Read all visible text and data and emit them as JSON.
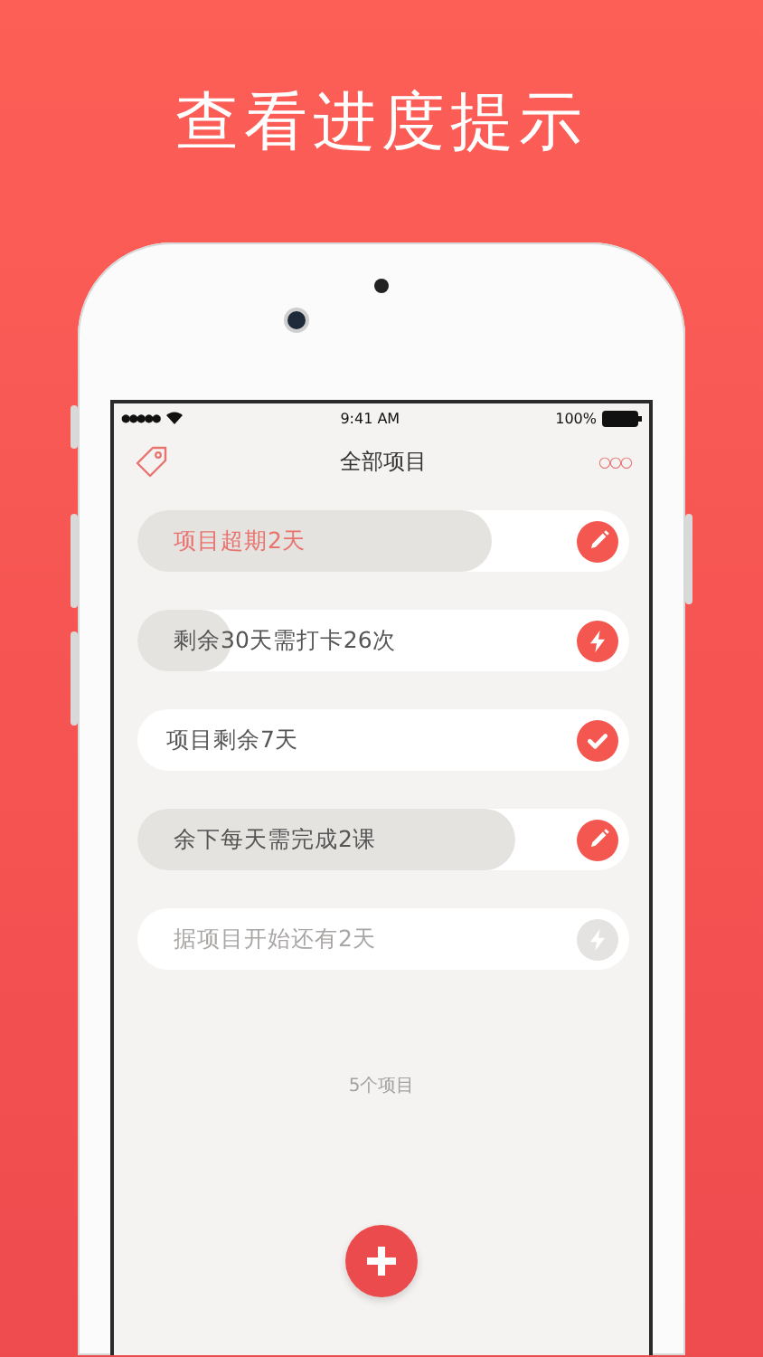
{
  "headline": "查看进度提示",
  "status_bar": {
    "carrier_dots": "●●●●●",
    "time": "9:41 AM",
    "battery": "100%"
  },
  "nav": {
    "title": "全部项目",
    "more": "○○○"
  },
  "projects": [
    {
      "text": "项目超期2天",
      "kind": "edit",
      "level": 0.72,
      "overdue": true,
      "pending": false
    },
    {
      "text": "剩余30天需打卡26次",
      "kind": "checkin",
      "level": 0.19,
      "overdue": false,
      "pending": false
    },
    {
      "text": "项目剩余7天",
      "kind": "done",
      "overdue": false,
      "pending": false
    },
    {
      "text": "余下每天需完成2课",
      "kind": "edit",
      "level": 0.77,
      "overdue": false,
      "pending": false
    },
    {
      "text": "据项目开始还有2天",
      "kind": "checkin",
      "overdue": false,
      "pending": true
    }
  ],
  "footer": "5个项目"
}
